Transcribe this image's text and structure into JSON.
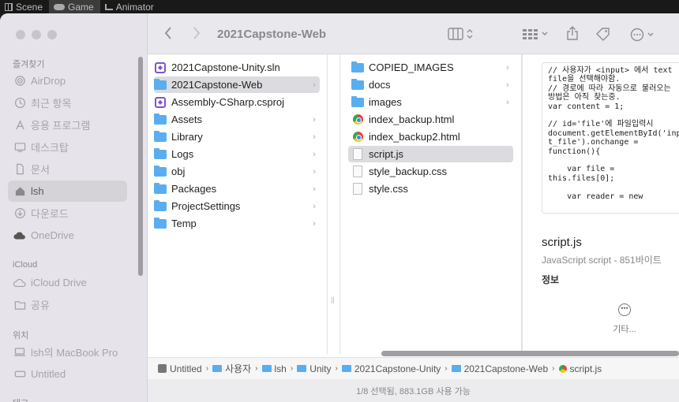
{
  "unity_tabs": [
    {
      "label": "Scene",
      "icon": "scene-icon"
    },
    {
      "label": "Game",
      "icon": "game-icon"
    },
    {
      "label": "Animator",
      "icon": "animator-icon"
    }
  ],
  "window": {
    "title": "2021Capstone-Web"
  },
  "sidebar": {
    "favorites_heading": "즐겨찾기",
    "favorites": [
      {
        "label": "AirDrop",
        "icon": "airdrop-icon"
      },
      {
        "label": "최근 항목",
        "icon": "clock-icon"
      },
      {
        "label": "응용 프로그램",
        "icon": "applications-icon"
      },
      {
        "label": "데스크탑",
        "icon": "desktop-icon"
      },
      {
        "label": "문서",
        "icon": "document-icon"
      },
      {
        "label": "lsh",
        "icon": "home-icon",
        "selected": true
      },
      {
        "label": "다운로드",
        "icon": "download-icon"
      },
      {
        "label": "OneDrive",
        "icon": "cloud-icon"
      }
    ],
    "icloud_heading": "iCloud",
    "icloud": [
      {
        "label": "iCloud Drive",
        "icon": "icloud-icon"
      },
      {
        "label": "공유",
        "icon": "shared-folder-icon"
      }
    ],
    "locations_heading": "위치",
    "locations": [
      {
        "label": "lsh의 MacBook Pro",
        "icon": "laptop-icon"
      },
      {
        "label": "Untitled",
        "icon": "disk-icon"
      }
    ],
    "tags_heading": "태그"
  },
  "column1": [
    {
      "name": "2021Capstone-Unity.sln",
      "type": "vs",
      "chevron": false
    },
    {
      "name": "2021Capstone-Web",
      "type": "folder",
      "chevron": true,
      "selected": true
    },
    {
      "name": "Assembly-CSharp.csproj",
      "type": "vs",
      "chevron": false
    },
    {
      "name": "Assets",
      "type": "folder",
      "chevron": true
    },
    {
      "name": "Library",
      "type": "folder",
      "chevron": true
    },
    {
      "name": "Logs",
      "type": "folder",
      "chevron": true
    },
    {
      "name": "obj",
      "type": "folder",
      "chevron": true
    },
    {
      "name": "Packages",
      "type": "folder",
      "chevron": true
    },
    {
      "name": "ProjectSettings",
      "type": "folder",
      "chevron": true
    },
    {
      "name": "Temp",
      "type": "folder",
      "chevron": true
    }
  ],
  "column2": [
    {
      "name": "COPIED_IMAGES",
      "type": "folder",
      "chevron": true
    },
    {
      "name": "docs",
      "type": "folder",
      "chevron": true
    },
    {
      "name": "images",
      "type": "folder",
      "chevron": true
    },
    {
      "name": "index_backup.html",
      "type": "chrome",
      "chevron": false
    },
    {
      "name": "index_backup2.html",
      "type": "chrome",
      "chevron": false
    },
    {
      "name": "script.js",
      "type": "doc",
      "chevron": false,
      "selected": true
    },
    {
      "name": "style_backup.css",
      "type": "doc",
      "chevron": false
    },
    {
      "name": "style.css",
      "type": "doc",
      "chevron": false
    }
  ],
  "preview": {
    "code": "// 사용자가 <input> 에서 text\nfile을 선택해야함.\n// 경로에 따라 자동으로 불러오는\n방법은 아직 찾는중.\nvar content = 1;\n\n// id='file'에 파일입력시\ndocument.getElementById('inpu\nt_file').onchange =\nfunction(){\n\n    var file =\nthis.files[0];\n\n    var reader = new",
    "file_name": "script.js",
    "kind": "JavaScript script - 851바이트",
    "info_heading": "정보",
    "more_label": "기타..."
  },
  "pathbar": [
    {
      "label": "Untitled",
      "icon": "disk-icon"
    },
    {
      "label": "사용자",
      "icon": "folder-icon"
    },
    {
      "label": "lsh",
      "icon": "folder-icon"
    },
    {
      "label": "Unity",
      "icon": "folder-icon"
    },
    {
      "label": "2021Capstone-Unity",
      "icon": "folder-icon"
    },
    {
      "label": "2021Capstone-Web",
      "icon": "folder-icon"
    },
    {
      "label": "script.js",
      "icon": "chrome-icon"
    }
  ],
  "status": "1/8 선택됨, 883.1GB 사용 가능"
}
